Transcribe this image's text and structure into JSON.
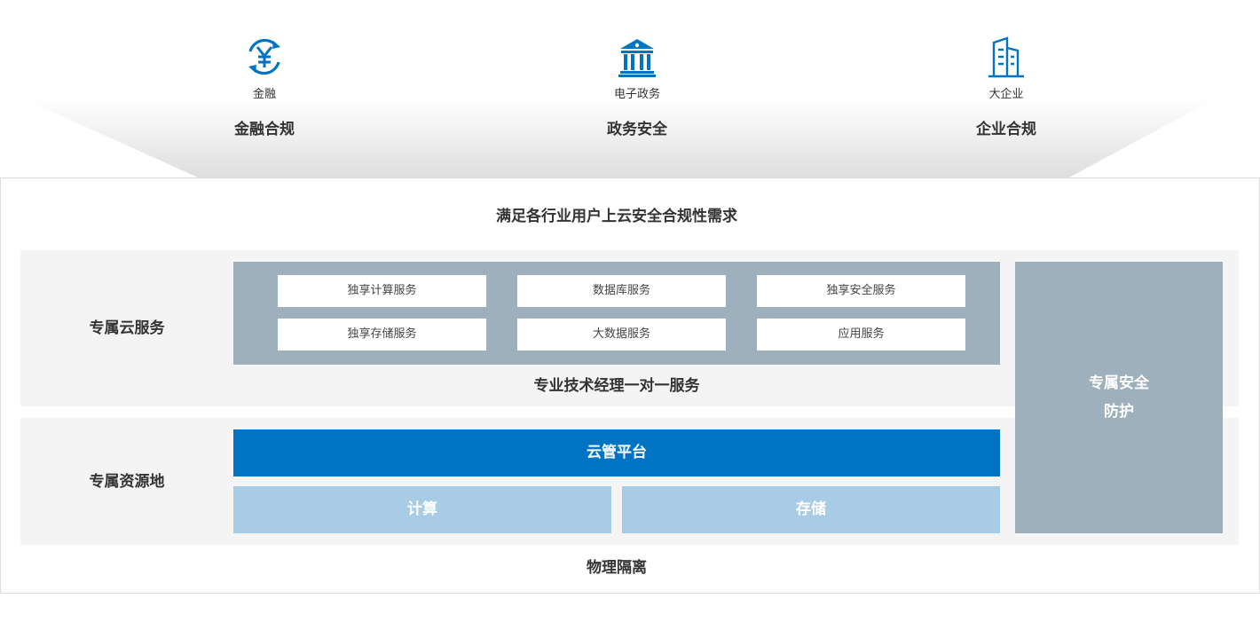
{
  "industries": [
    {
      "icon": "yen-exchange-icon",
      "label": "金融",
      "title": "金融合规"
    },
    {
      "icon": "government-building-icon",
      "label": "电子政务",
      "title": "政务安全"
    },
    {
      "icon": "office-building-icon",
      "label": "大企业",
      "title": "企业合规"
    }
  ],
  "headline": "满足各行业用户上云安全合规性需求",
  "dedicated_service": {
    "label": "专属云服务",
    "services": [
      "独享计算服务",
      "数据库服务",
      "独享安全服务",
      "独享存储服务",
      "大数据服务",
      "应用服务"
    ],
    "manager": "专业技术经理一对一服务"
  },
  "dedicated_resource": {
    "label": "专属资源地",
    "platform": "云管平台",
    "compute": "计算",
    "storage": "存储"
  },
  "security": {
    "line1": "专属安全",
    "line2": "防护"
  },
  "footer": "物理隔离",
  "colors": {
    "primary": "#0073c2",
    "grey_block": "#9fb0bd",
    "light_blue": "#a9cce6",
    "band": "#f4f4f4"
  }
}
